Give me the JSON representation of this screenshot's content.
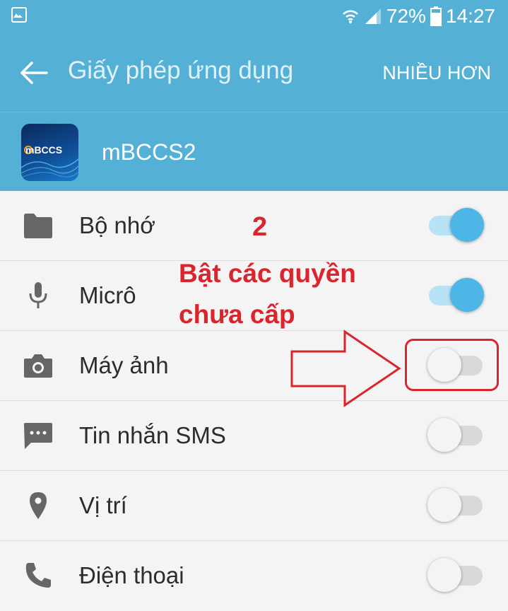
{
  "status_bar": {
    "battery": "72%",
    "time": "14:27"
  },
  "app_bar": {
    "title": "Giấy phép ứng dụng",
    "more_label": "NHIỀU HƠN"
  },
  "app": {
    "name": "mBCCS2",
    "icon_text": "mBCCS"
  },
  "permissions": [
    {
      "label": "Bộ nhớ",
      "icon": "folder-icon",
      "enabled": true
    },
    {
      "label": "Micrô",
      "icon": "microphone-icon",
      "enabled": true
    },
    {
      "label": "Máy ảnh",
      "icon": "camera-icon",
      "enabled": false
    },
    {
      "label": "Tin nhắn SMS",
      "icon": "sms-icon",
      "enabled": false
    },
    {
      "label": "Vị trí",
      "icon": "location-icon",
      "enabled": false
    },
    {
      "label": "Điện thoại",
      "icon": "phone-icon",
      "enabled": false
    }
  ],
  "annotation": {
    "step": "2",
    "line1": "Bật các quyền",
    "line2": "chưa cấp"
  },
  "colors": {
    "header": "#55b0d6",
    "toggle_on": "#4cb7e6",
    "annotation": "#d9252d"
  }
}
